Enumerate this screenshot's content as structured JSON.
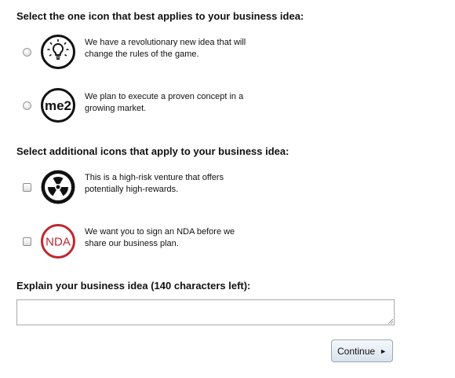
{
  "section1": {
    "heading": "Select the one icon that best applies to your business idea:",
    "options": [
      {
        "icon": "lightbulb-icon",
        "text": "We have a revolutionary new idea that will change the rules of the game.",
        "selected": false
      },
      {
        "icon": "me2-icon",
        "icon_text": "me2",
        "text": "We plan to execute a proven concept in a growing market.",
        "selected": false
      }
    ]
  },
  "section2": {
    "heading": "Select additional icons that apply to your business idea:",
    "options": [
      {
        "icon": "radiation-icon",
        "text": "This is a high-risk venture that offers potentially high-rewards.",
        "checked": false
      },
      {
        "icon": "nda-icon",
        "icon_text": "NDA",
        "text": "We want you to sign an NDA before we share our business plan.",
        "checked": false
      }
    ]
  },
  "explain": {
    "label": "Explain your business idea (140 characters left):",
    "value": ""
  },
  "continue_button": {
    "label": "Continue",
    "arrow": "►"
  },
  "colors": {
    "nda_red": "#c0272d",
    "icon_black": "#111111"
  }
}
